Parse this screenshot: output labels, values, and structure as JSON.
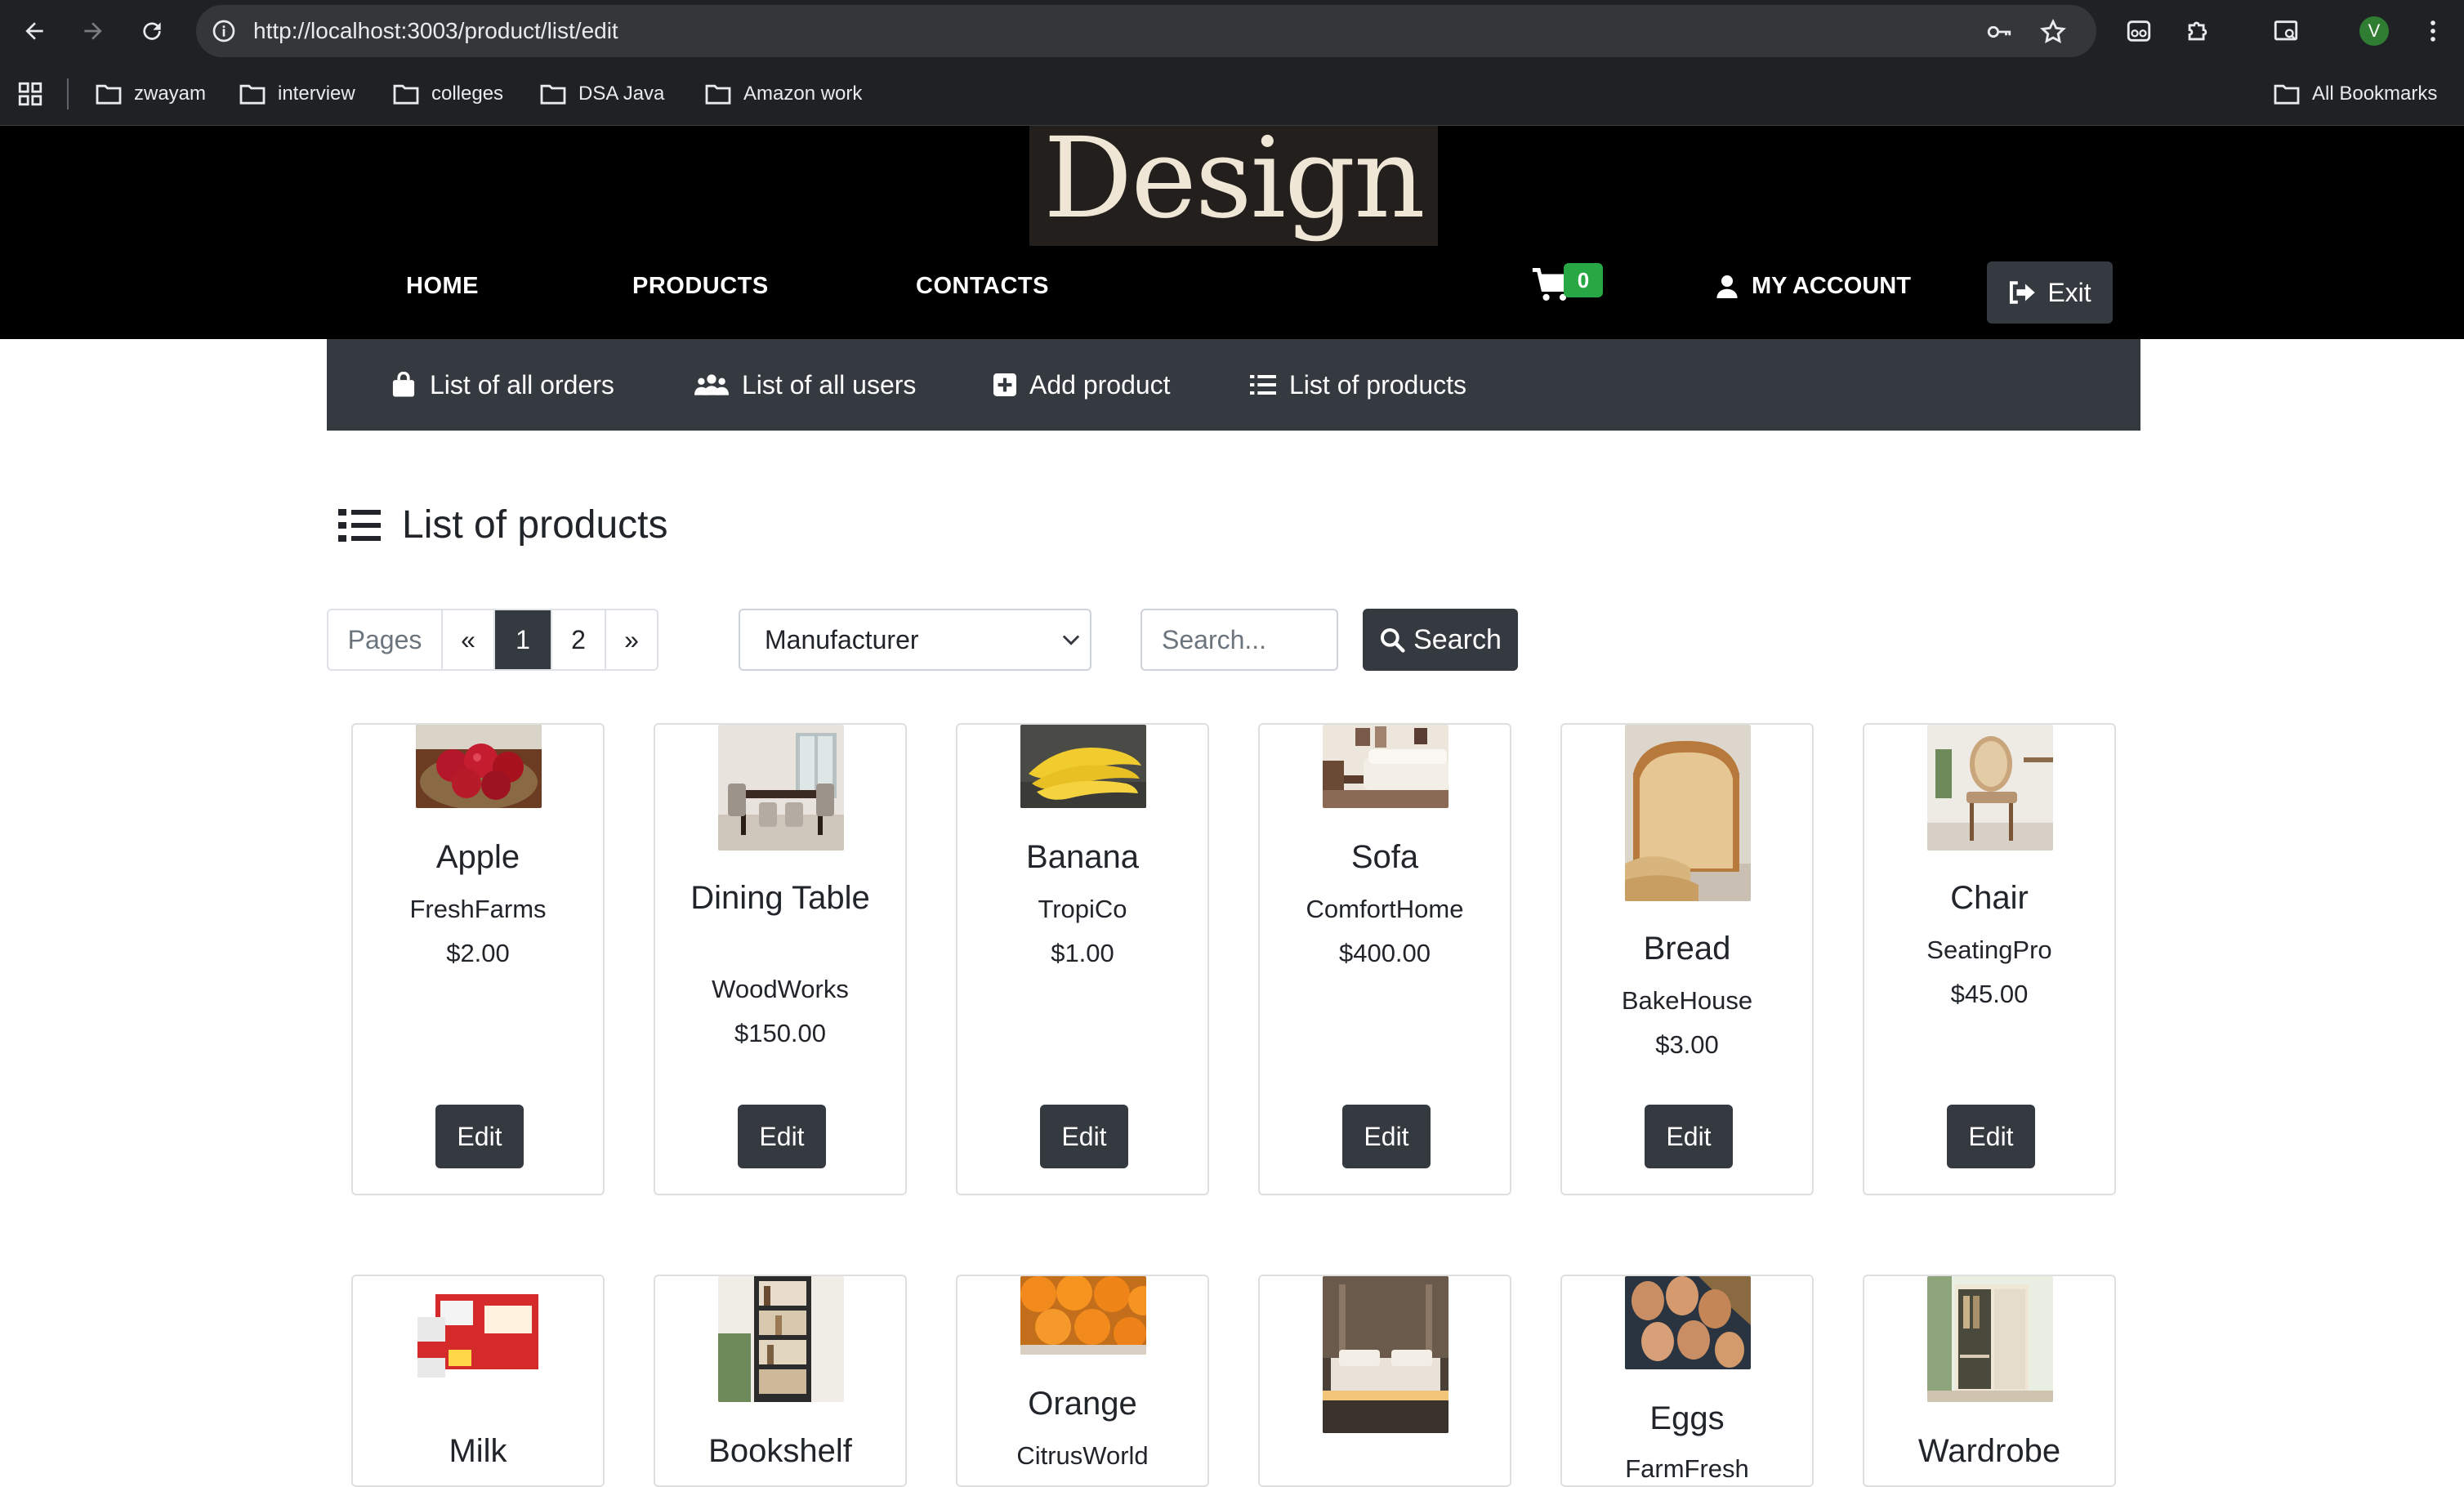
{
  "browser": {
    "url": "http://localhost:3003/product/list/edit",
    "avatar_letter": "V",
    "bookmarks": [
      "zwayam",
      "interview",
      "colleges",
      "DSA Java",
      "Amazon work"
    ],
    "all_bookmarks": "All Bookmarks"
  },
  "site": {
    "logo": "Design",
    "nav": [
      "HOME",
      "PRODUCTS",
      "CONTACTS"
    ],
    "cart_count": "0",
    "account": "MY ACCOUNT",
    "exit": "Exit"
  },
  "admin_nav": [
    "List of all orders",
    "List of all users",
    "Add product",
    "List of products"
  ],
  "page_title": "List of products",
  "pagination": {
    "label": "Pages",
    "prev": "«",
    "pages": [
      "1",
      "2"
    ],
    "next": "»",
    "current": "1"
  },
  "filter": {
    "selected": "Manufacturer"
  },
  "search": {
    "placeholder": "Search...",
    "button": "Search"
  },
  "edit_label": "Edit",
  "products": [
    {
      "name": "Apple",
      "manufacturer": "FreshFarms",
      "price": "$2.00",
      "image": "apple-photo"
    },
    {
      "name": "Dining Table",
      "manufacturer": "WoodWorks",
      "price": "$150.00",
      "image": "dining-table-photo"
    },
    {
      "name": "Banana",
      "manufacturer": "TropiCo",
      "price": "$1.00",
      "image": "banana-photo"
    },
    {
      "name": "Sofa",
      "manufacturer": "ComfortHome",
      "price": "$400.00",
      "image": "sofa-photo"
    },
    {
      "name": "Bread",
      "manufacturer": "BakeHouse",
      "price": "$3.00",
      "image": "bread-photo"
    },
    {
      "name": "Chair",
      "manufacturer": "SeatingPro",
      "price": "$45.00",
      "image": "chair-photo"
    },
    {
      "name": "Milk",
      "image": "milk-photo"
    },
    {
      "name": "Bookshelf",
      "image": "bookshelf-photo"
    },
    {
      "name": "Orange",
      "manufacturer": "CitrusWorld",
      "image": "orange-photo"
    },
    {
      "name": "",
      "image": "bed-photo"
    },
    {
      "name": "Eggs",
      "manufacturer": "FarmFresh",
      "image": "eggs-photo"
    },
    {
      "name": "Wardrobe",
      "image": "wardrobe-photo"
    }
  ]
}
